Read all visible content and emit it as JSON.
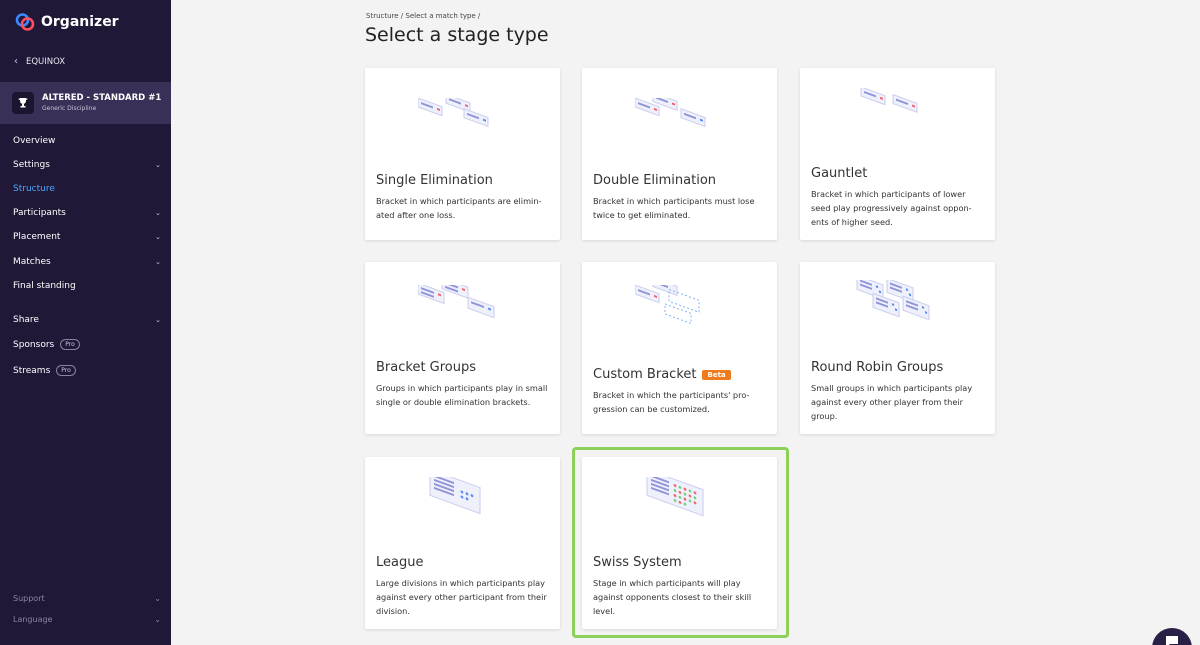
{
  "app": {
    "name": "Organizer"
  },
  "back": {
    "label": "EQUINOX"
  },
  "tournament": {
    "name": "ALTERED - STANDARD #1",
    "discipline": "Generic Discipline"
  },
  "nav": {
    "overview": "Overview",
    "settings": "Settings",
    "structure": "Structure",
    "participants": "Participants",
    "placement": "Placement",
    "matches": "Matches",
    "final_standing": "Final standing",
    "share": "Share",
    "sponsors": "Sponsors",
    "streams": "Streams",
    "pro_badge": "Pro",
    "support": "Support",
    "language": "Language",
    "active": "Structure"
  },
  "breadcrumb": {
    "path": "Structure  / Select a match type /"
  },
  "page": {
    "title": "Select a stage type"
  },
  "cards": [
    {
      "title": "Single Elimination",
      "desc": "Bracket in which participants are elimin-ated after one loss."
    },
    {
      "title": "Double Elimination",
      "desc": "Bracket in which participants must lose twice to get eliminated."
    },
    {
      "title": "Gauntlet",
      "desc": "Bracket in which participants of lower seed play progressively against oppon-ents of higher seed."
    },
    {
      "title": "Bracket Groups",
      "desc": "Groups in which participants play in small single or double elimination brackets."
    },
    {
      "title": "Custom Bracket",
      "badge": "Beta",
      "desc": "Bracket in which the participants' pro-gression can be customized."
    },
    {
      "title": "Round Robin Groups",
      "desc": "Small groups in which participants play against every other player from their group."
    },
    {
      "title": "League",
      "desc": "Large divisions in which participants play against every other participant from their division."
    },
    {
      "title": "Swiss System",
      "desc": "Stage in which participants will play against opponents closest to their skill level."
    }
  ],
  "selected_card": "Swiss System",
  "colors": {
    "sidebar": "#211838",
    "active_nav": "#4aa8ff",
    "highlight": "#8ed15a",
    "beta": "#f07b1d"
  }
}
